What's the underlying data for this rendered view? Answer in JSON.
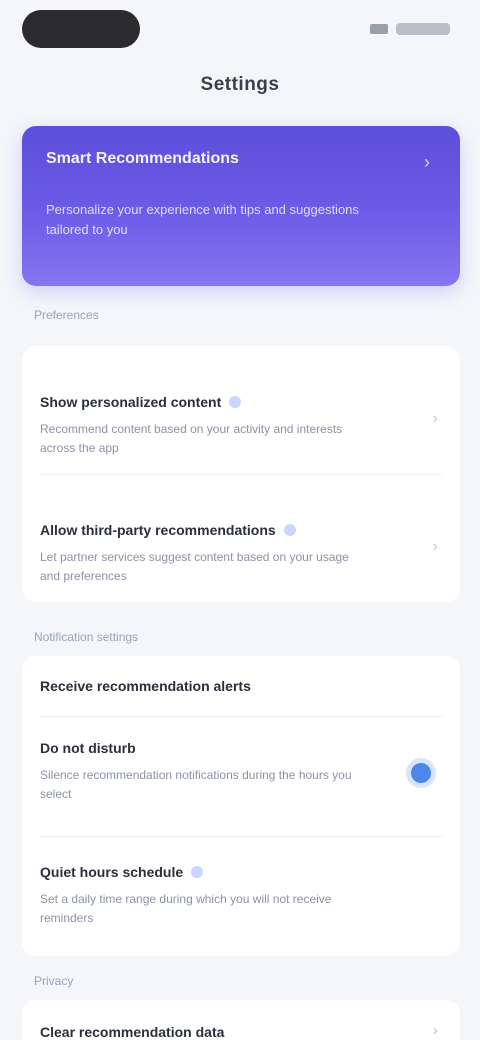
{
  "status": {
    "time": ""
  },
  "header": {
    "title": "Settings"
  },
  "banner": {
    "title": "Smart Recommendations",
    "subtitle": "Personalize your experience with tips and suggestions tailored to you",
    "chevron": "›"
  },
  "section1": {
    "label": "Preferences",
    "items": [
      {
        "title": "Show personalized content",
        "desc": "Recommend content based on your activity and interests across the app",
        "chevron": "›"
      },
      {
        "title": "Allow third-party recommendations",
        "desc": "Let partner services suggest content based on your usage and preferences",
        "chevron": "›"
      }
    ]
  },
  "section2": {
    "label": "Notification settings",
    "items": [
      {
        "title": "Receive recommendation alerts"
      },
      {
        "title": "Do not disturb",
        "desc": "Silence recommendation notifications during the hours you select",
        "selected": true
      },
      {
        "title": "Quiet hours schedule",
        "desc": "Set a daily time range during which you will not receive reminders"
      }
    ]
  },
  "section3": {
    "label": "Privacy",
    "items": [
      {
        "title": "Clear recommendation data",
        "chevron": "›"
      }
    ]
  }
}
